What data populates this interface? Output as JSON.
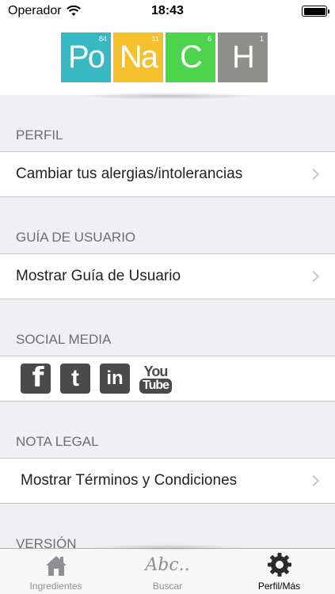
{
  "status_bar": {
    "carrier": "Operador",
    "time": "18:43"
  },
  "logo": {
    "tiles": [
      {
        "symbol": "Po",
        "number": "84",
        "color": "#37b8c3"
      },
      {
        "symbol": "Na",
        "number": "11",
        "color": "#f4c12d"
      },
      {
        "symbol": "C",
        "number": "6",
        "color": "#4cd44c"
      },
      {
        "symbol": "H",
        "number": "1",
        "color": "#8e8e8a"
      }
    ]
  },
  "sections": {
    "perfil": {
      "header": "PERFIL",
      "item": "Cambiar tus alergias/intolerancias"
    },
    "guia": {
      "header": "GUÍA DE USUARIO",
      "item": "Mostrar Guía de Usuario"
    },
    "social": {
      "header": "SOCIAL MEDIA",
      "icons": [
        "facebook-icon",
        "twitter-icon",
        "linkedin-icon",
        "youtube-icon"
      ],
      "youtube_top": "You",
      "youtube_bottom": "Tube"
    },
    "legal": {
      "header": "NOTA LEGAL",
      "item": "Mostrar Términos y Condiciones"
    },
    "version": {
      "header": "VERSIÓN"
    }
  },
  "tabbar": {
    "tabs": [
      {
        "label": "Ingredientes",
        "icon": "home-icon",
        "active": false
      },
      {
        "label": "Buscar",
        "icon": "abc-icon",
        "icon_text": "Abc..",
        "active": false
      },
      {
        "label": "Perfil/Más",
        "icon": "gear-icon",
        "active": true
      }
    ]
  }
}
